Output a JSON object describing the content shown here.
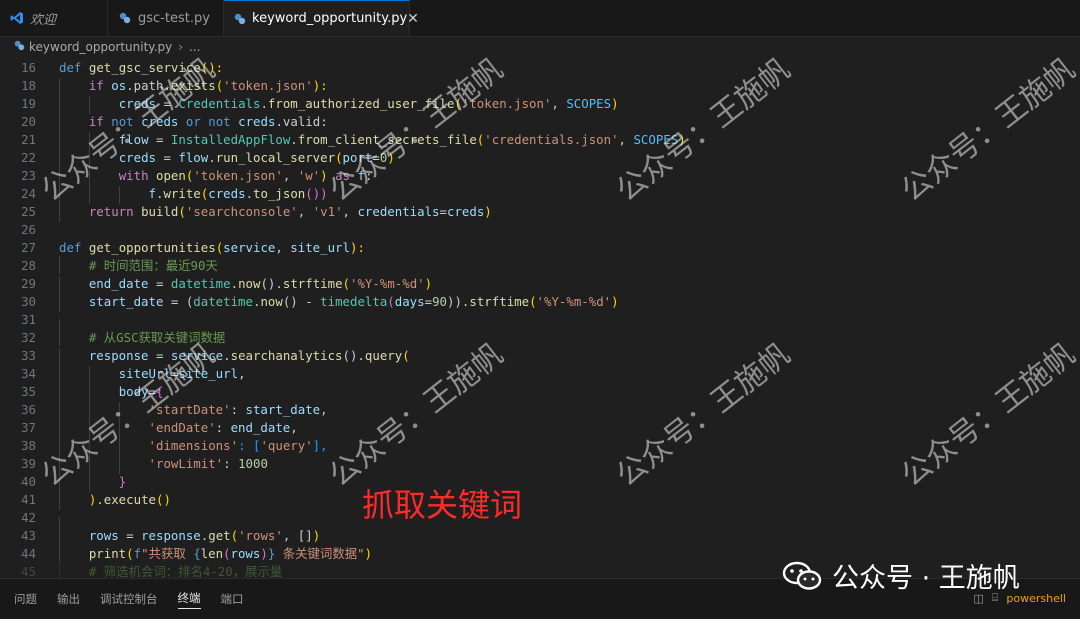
{
  "tabs": [
    {
      "label": "欢迎",
      "icon": "vscode-icon"
    },
    {
      "label": "gsc-test.py",
      "icon": "python-file-icon"
    },
    {
      "label": "keyword_opportunity.py",
      "icon": "python-file-icon",
      "active": true
    }
  ],
  "breadcrumb": {
    "file": "keyword_opportunity.py",
    "more": "..."
  },
  "line_numbers": [
    "16",
    "18",
    "19",
    "20",
    "21",
    "22",
    "23",
    "24",
    "25",
    "26",
    "27",
    "28",
    "29",
    "30",
    "31",
    "32",
    "33",
    "34",
    "35",
    "36",
    "37",
    "38",
    "39",
    "40",
    "41",
    "42",
    "43",
    "44",
    "45"
  ],
  "code": {
    "l16": {
      "kw": "def",
      "fn": "get_gsc_service",
      "rest": "():"
    },
    "l18": {
      "kw": "if",
      "v1": "os",
      "t1": ".path.",
      "fn": "exists",
      "s": "'token.json'",
      "end": "):"
    },
    "l19": {
      "v": "creds",
      "eq": " = ",
      "cls": "Credentials",
      "dot": ".",
      "fn": "from_authorized_user_file",
      "s": "'token.json'",
      "c": ", ",
      "const": "SCOPES",
      "end": ")"
    },
    "l20": {
      "kw": "if",
      "n1": "not",
      "v1": "creds",
      "or": "or",
      "n2": "not",
      "v2": "creds",
      "t": ".valid:"
    },
    "l21": {
      "v": "flow",
      "eq": " = ",
      "cls": "InstalledAppFlow",
      "dot": ".",
      "fn": "from_client_secrets_file",
      "s": "'credentials.json'",
      "c": ", ",
      "const": "SCOPES",
      "end": ")"
    },
    "l22": {
      "v": "creds",
      "eq": " = ",
      "v2": "flow",
      "dot": ".",
      "fn": "run_local_server",
      "p": "port",
      "eqn": "=",
      "num": "0",
      "end": ")"
    },
    "l23": {
      "kw": "with",
      "fn": "open",
      "s1": "'token.json'",
      "c": ", ",
      "s2": "'w'",
      "as": "as",
      "v": "f",
      "end": ":"
    },
    "l24": {
      "v": "f",
      "dot": ".",
      "fn": "write",
      "v2": "creds",
      "dot2": ".",
      "fn2": "to_json",
      "end": "())"
    },
    "l25": {
      "kw": "return",
      "fn": "build",
      "s1": "'searchconsole'",
      "c": ", ",
      "s2": "'v1'",
      "c2": ", ",
      "p": "credentials",
      "eqn": "=",
      "v": "creds",
      "end": ")"
    },
    "l27": {
      "kw": "def",
      "fn": "get_opportunities",
      "p1": "service",
      "c": ", ",
      "p2": "site_url",
      "end": "):"
    },
    "l28": {
      "cm": "# 时间范围：最近90天"
    },
    "l29": {
      "v": "end_date",
      "eq": " = ",
      "cls": "datetime",
      "dot": ".",
      "fn": "now",
      "mid": "().",
      "fn2": "strftime",
      "s": "'%Y-%m-%d'",
      "end": ")"
    },
    "l30": {
      "v": "start_date",
      "eq": " = (",
      "cls": "datetime",
      "dot": ".",
      "fn": "now",
      "mid": "() - ",
      "cls2": "timedelta",
      "p": "days",
      "eqn": "=",
      "num": "90",
      "mid2": ")).",
      "fn2": "strftime",
      "s": "'%Y-%m-%d'",
      "end": ")"
    },
    "l32": {
      "cm": "# 从GSC获取关键词数据"
    },
    "l33": {
      "v": "response",
      "eq": " = ",
      "v2": "service",
      "dot": ".",
      "fn": "searchanalytics",
      "mid": "().",
      "fn2": "query",
      "end": "("
    },
    "l34": {
      "p": "siteUrl",
      "eqn": "=",
      "v": "site_url",
      "end": ","
    },
    "l35": {
      "p": "body",
      "eqn": "=",
      "end": "{"
    },
    "l36": {
      "s": "'startDate'",
      "c": ": ",
      "v": "start_date",
      "end": ","
    },
    "l37": {
      "s": "'endDate'",
      "c": ": ",
      "v": "end_date",
      "end": ","
    },
    "l38": {
      "s": "'dimensions'",
      "c": ": [",
      "s2": "'query'",
      "end": "],"
    },
    "l39": {
      "s": "'rowLimit'",
      "c": ": ",
      "num": "1000"
    },
    "l40": {
      "end": "}"
    },
    "l41": {
      "end": ").",
      "fn": "execute",
      "end2": "()"
    },
    "l43": {
      "v": "rows",
      "eq": " = ",
      "v2": "response",
      "dot": ".",
      "fn": "get",
      "s": "'rows'",
      "c": ", []",
      "end": ")"
    },
    "l44": {
      "fn": "print",
      "f": "f",
      "s1": "\"共获取 ",
      "br": "{",
      "fn2": "len",
      "v": "rows",
      "br2": "}",
      "s2": " 条关键词数据\"",
      "end": ")"
    },
    "l45": {
      "cm": "# 筛选机会词：排名4-20，展示量"
    }
  },
  "overlay_title": "抓取关键词",
  "panel": {
    "tabs": [
      "问题",
      "输出",
      "调试控制台",
      "终端",
      "端口"
    ],
    "active_tab": "终端",
    "terminal_label": "powershell"
  },
  "watermark": "公众号：王施帆",
  "badge": "公众号 · 王施帆",
  "colors": {
    "keyword": "#569cd6",
    "control": "#c586c0",
    "function": "#dcdcaa",
    "string": "#ce9178",
    "class": "#4ec9b0",
    "variable": "#9cdcfe",
    "number": "#b5cea8",
    "comment": "#6a9955",
    "overlay": "#ff2a2a",
    "tab_accent": "#0078d4"
  }
}
